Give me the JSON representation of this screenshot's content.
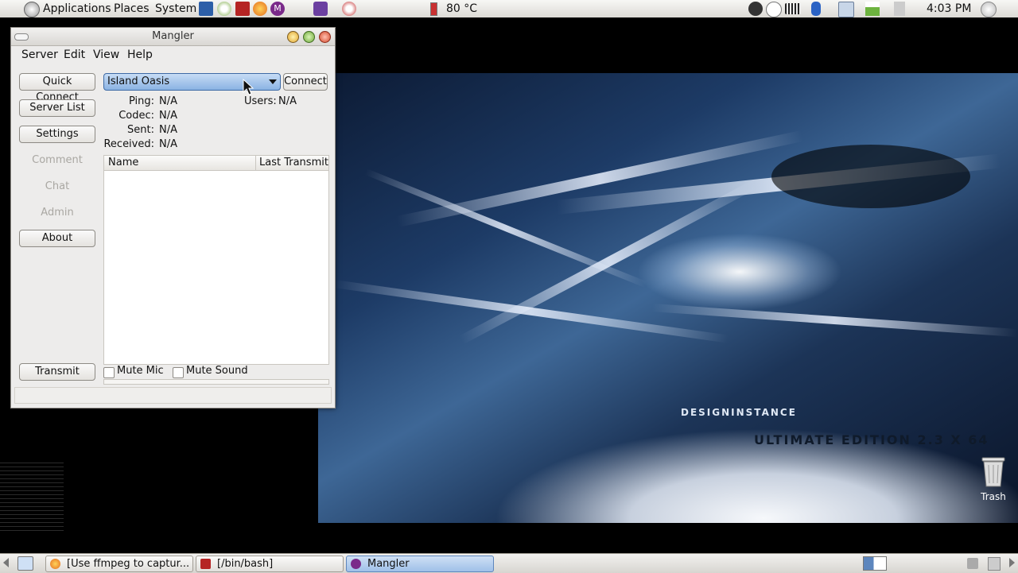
{
  "top_panel": {
    "menus": [
      "Applications",
      "Places",
      "System"
    ],
    "temperature": "80 °C",
    "clock": "4:03 PM"
  },
  "window": {
    "title": "Mangler",
    "menus": [
      "Server",
      "Edit",
      "View",
      "Help"
    ],
    "sidebar": {
      "quick_connect": "Quick Connect",
      "server_list": "Server List",
      "settings": "Settings",
      "comment": "Comment",
      "chat": "Chat",
      "admin": "Admin",
      "about": "About",
      "transmit": "Transmit"
    },
    "server": {
      "selected": "Island Oasis",
      "connect_label": "Connect"
    },
    "stats": {
      "ping_label": "Ping:",
      "ping_value": "N/A",
      "codec_label": "Codec:",
      "codec_value": "N/A",
      "sent_label": "Sent:",
      "sent_value": "N/A",
      "received_label": "Received:",
      "received_value": "N/A",
      "users_label": "Users:",
      "users_value": "N/A"
    },
    "columns": {
      "name": "Name",
      "last_transmit": "Last Transmit"
    },
    "checkboxes": {
      "mute_mic": "Mute Mic",
      "mute_sound": "Mute Sound"
    }
  },
  "desktop": {
    "trash_label": "Trash",
    "wallpaper_text": {
      "brand": "DESIGNINSTANCE",
      "edition": "ULTIMATE EDITION 2.3 X 64"
    }
  },
  "taskbar": [
    {
      "label": "[Use ffmpeg to captur...",
      "active": false
    },
    {
      "label": "[/bin/bash]",
      "active": false
    },
    {
      "label": "Mangler",
      "active": true
    }
  ]
}
